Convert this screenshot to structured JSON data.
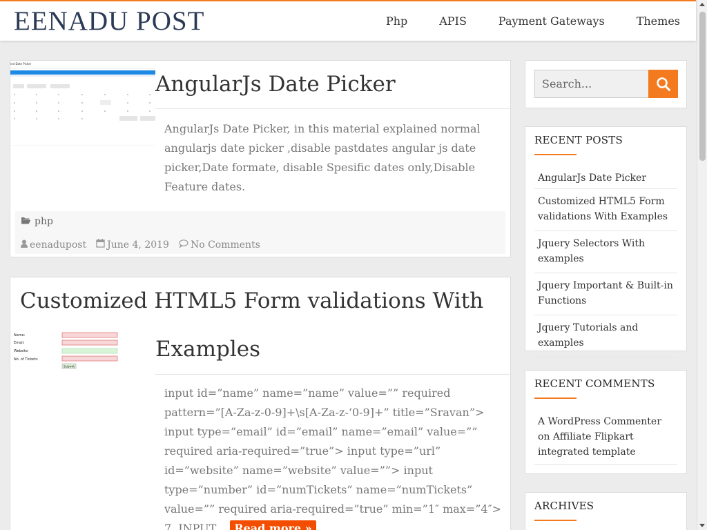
{
  "site": {
    "logo": "EENADU POST"
  },
  "nav": {
    "items": [
      "Php",
      "APIS",
      "Payment Gateways",
      "Themes"
    ]
  },
  "posts": [
    {
      "title": "AngularJs Date Picker",
      "excerpt": "AngularJs Date Picker, in this material explained normal angularjs date picker ,disable pastdates angular js date picker,Date formate, disable Spesific dates only,Disable Feature dates.",
      "category": "php",
      "author": "eenadupost",
      "date": "June 4, 2019",
      "comments": "No Comments"
    },
    {
      "title_line1": "Customized HTML5 Form validations With",
      "title_line2": "Examples",
      "excerpt": "input id=”name” name=”name” value=”” required pattern=”[A-Za-z-0-9]+\\s[A-Za-z-‘0-9]+” title=”Sravan”> input type=”email” id=”email” name=”email” value=”” required aria-required=”true”> input type=”url” id=”website” name=”website” value=””> input type=”number” id=”numTickets” name=”numTickets” value=”” required aria-required=”true” min=”1″ max=”4″> 7. INPUT…",
      "read_more": "Read more »",
      "thumb_labels": [
        "Name:",
        "Email:",
        "Website:",
        "No. of Tickets:"
      ],
      "thumb_submit": "Submit"
    }
  ],
  "thumb1": {
    "header": "ind Date Picker"
  },
  "sidebar": {
    "search_placeholder": "Search...",
    "recent_posts_title": "RECENT POSTS",
    "recent_posts": [
      "AngularJs Date Picker",
      "Customized HTML5 Form validations With Examples",
      "Jquery Selectors With examples",
      "Jquery Important & Built-in Functions",
      "Jquery Tutorials and examples"
    ],
    "recent_comments_title": "RECENT COMMENTS",
    "recent_comment": {
      "author": "A WordPress Commenter",
      "on": "on",
      "post": "Affiliate Flipkart integrated template"
    },
    "archives_title": "ARCHIVES"
  },
  "colors": {
    "accent": "#f37a1f",
    "readmore": "#f34e00",
    "logo": "#2b3a55"
  },
  "icons": {
    "search": "search-icon",
    "folder": "folder-open-icon",
    "user": "user-icon",
    "calendar": "calendar-icon",
    "comment": "comment-icon"
  }
}
